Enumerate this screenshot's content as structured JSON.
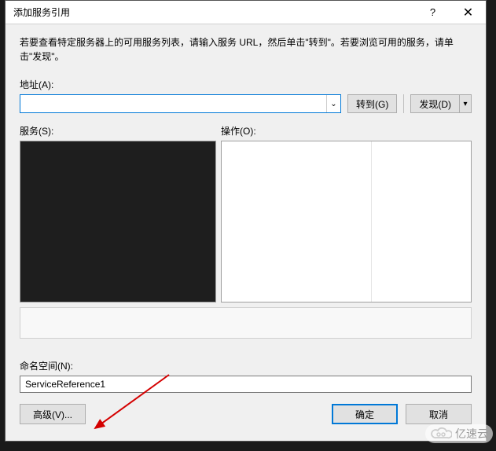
{
  "titlebar": {
    "title": "添加服务引用",
    "help": "?",
    "close": "✕"
  },
  "instruction": "若要查看特定服务器上的可用服务列表，请输入服务 URL，然后单击\"转到\"。若要浏览可用的服务，请单击\"发现\"。",
  "labels": {
    "address": "地址(A):",
    "services": "服务(S):",
    "operations": "操作(O):",
    "namespace": "命名空间(N):"
  },
  "address": {
    "value": "",
    "dropdown": "⌄"
  },
  "buttons": {
    "go": "转到(G)",
    "discover": "发现(D)",
    "discover_dd": "▾",
    "advanced": "高级(V)...",
    "ok": "确定",
    "cancel": "取消"
  },
  "namespace": {
    "value": "ServiceReference1"
  },
  "watermark": "亿速云"
}
